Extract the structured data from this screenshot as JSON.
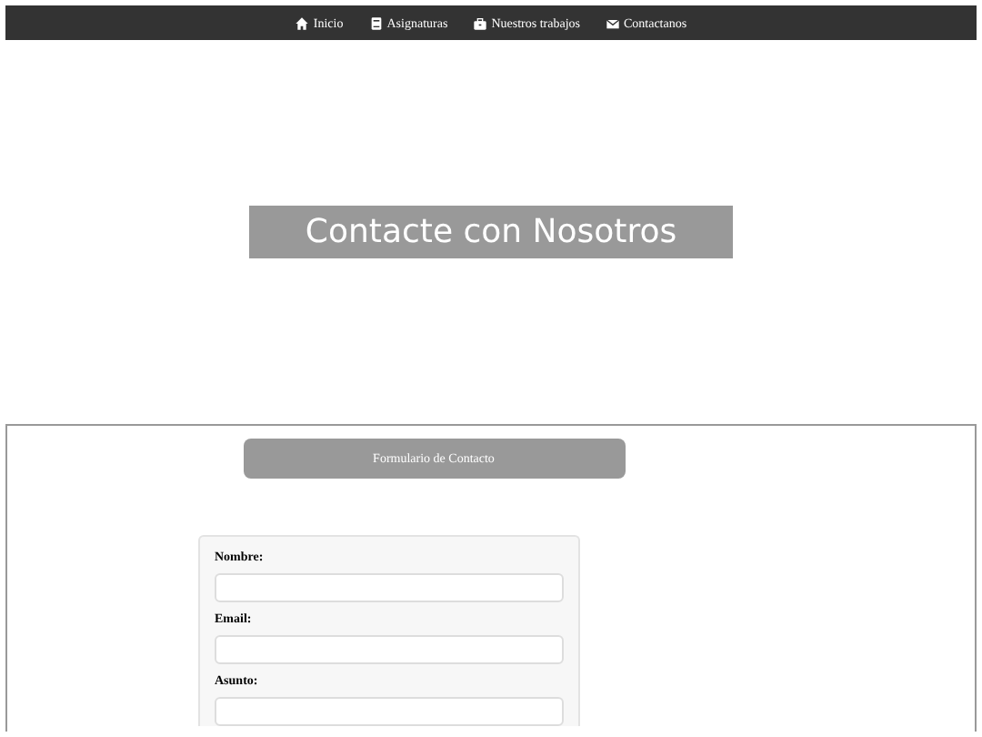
{
  "nav": [
    {
      "label": "Inicio"
    },
    {
      "label": "Asignaturas"
    },
    {
      "label": "Nuestros trabajos"
    },
    {
      "label": "Contactanos"
    }
  ],
  "hero": {
    "title": "Contacte con Nosotros"
  },
  "form": {
    "header": "Formulario de Contacto",
    "fields": [
      {
        "label": "Nombre:"
      },
      {
        "label": "Email:"
      },
      {
        "label": "Asunto:"
      }
    ]
  }
}
